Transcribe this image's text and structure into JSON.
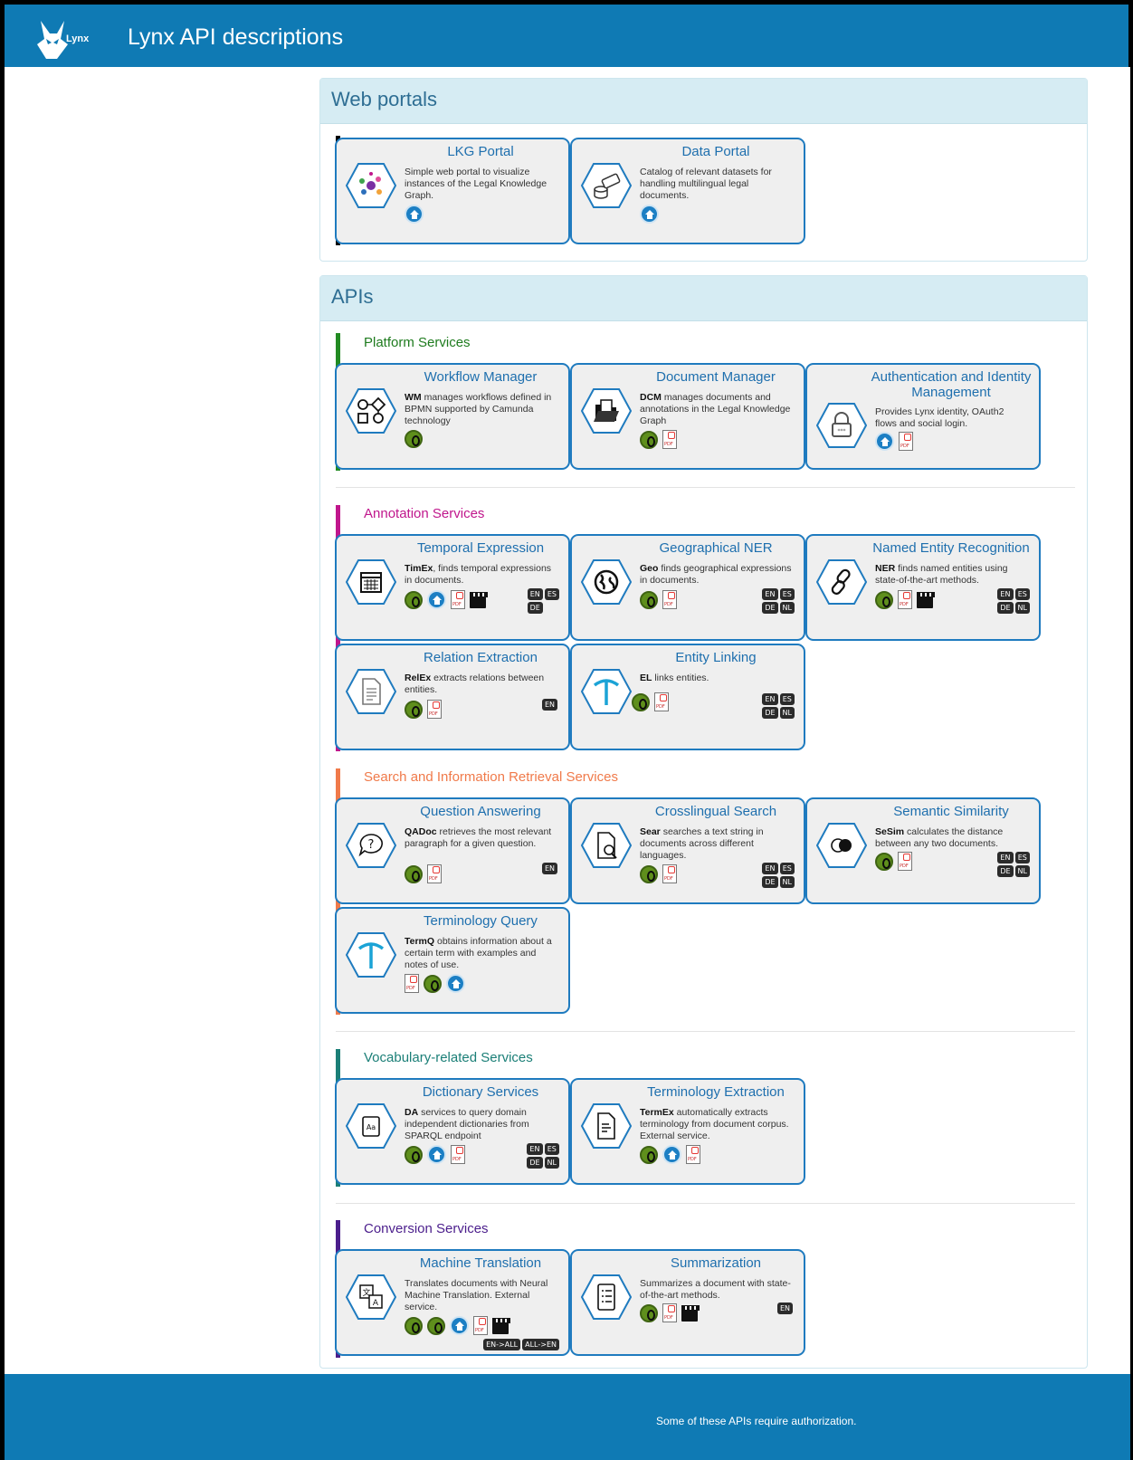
{
  "header": {
    "app_title": "Lynx API descriptions",
    "logo_text": "Lynx"
  },
  "web_portals": {
    "heading": "Web portals",
    "cards": [
      {
        "title": "LKG Portal",
        "description": "Simple web portal to visualize instances of the Legal Knowledge Graph.",
        "icon": "network-graph-icon"
      },
      {
        "title": "Data Portal",
        "description": "Catalog of relevant datasets for handling multilingual legal documents.",
        "icon": "database-tag-icon"
      }
    ]
  },
  "apis": {
    "heading": "APIs",
    "groups": [
      {
        "title": "Platform Services",
        "color": "#228b22",
        "cards": [
          {
            "title": "Workflow Manager",
            "abbr": "WM",
            "description": " manages workflows defined in BPMN supported by Camunda technology",
            "icon": "workflow-icon",
            "links": [
              "swagger"
            ],
            "langs": []
          },
          {
            "title": "Document Manager",
            "abbr": "DCM",
            "description": " manages documents and annotations in the Legal Knowledge Graph",
            "icon": "folder-document-icon",
            "links": [
              "swagger",
              "pdf"
            ],
            "langs": []
          },
          {
            "title": "Authentication and Identity Management",
            "abbr": "",
            "description": "Provides Lynx identity, OAuth2 flows and social login.",
            "icon": "lock-icon",
            "links": [
              "home",
              "pdf"
            ],
            "langs": []
          }
        ]
      },
      {
        "title": "Annotation Services",
        "color": "#c0168c",
        "cards": [
          {
            "title": "Temporal Expression",
            "abbr": "TimEx",
            "description": ", finds temporal expressions in documents.",
            "icon": "calendar-icon",
            "links": [
              "swagger",
              "home",
              "pdf",
              "video"
            ],
            "langs": [
              "EN",
              "ES",
              "DE"
            ]
          },
          {
            "title": "Geographical NER",
            "abbr": "Geo",
            "description": " finds geographical expressions in documents.",
            "icon": "globe-icon",
            "links": [
              "swagger",
              "pdf"
            ],
            "langs": [
              "EN",
              "ES",
              "DE",
              "NL"
            ]
          },
          {
            "title": "Named Entity Recognition",
            "abbr": "NER",
            "description": " finds named entities using state-of-the-art methods.",
            "icon": "link-icon",
            "links": [
              "swagger",
              "pdf",
              "video"
            ],
            "langs": [
              "EN",
              "ES",
              "DE",
              "NL"
            ]
          },
          {
            "title": "Relation Extraction",
            "abbr": "RelEx",
            "description": " extracts relations between entities.",
            "icon": "document-list-icon",
            "links": [
              "swagger",
              "pdf"
            ],
            "langs": [
              "EN"
            ]
          },
          {
            "title": "Entity Linking",
            "abbr": "EL",
            "description": " links entities.",
            "icon": "pickaxe-icon",
            "links": [
              "swagger",
              "pdf"
            ],
            "langs": [
              "EN",
              "ES",
              "DE",
              "NL"
            ]
          }
        ]
      },
      {
        "title": "Search and Information Retrieval Services",
        "color": "#f07a4a",
        "cards": [
          {
            "title": "Question Answering",
            "abbr": "QADoc",
            "description": " retrieves the most relevant paragraph for a given question.",
            "icon": "question-bubble-icon",
            "links": [
              "swagger",
              "pdf"
            ],
            "langs": [
              "EN"
            ]
          },
          {
            "title": "Crosslingual Search",
            "abbr": "Sear",
            "description": " searches a text string in documents across different languages.",
            "icon": "document-search-icon",
            "links": [
              "swagger",
              "pdf"
            ],
            "langs": [
              "EN",
              "ES",
              "DE",
              "NL"
            ]
          },
          {
            "title": "Semantic Similarity",
            "abbr": "SeSim",
            "description": " calculates the distance between any two documents.",
            "icon": "overlap-circles-icon",
            "links": [
              "swagger",
              "pdf"
            ],
            "langs": [
              "EN",
              "ES",
              "DE",
              "NL"
            ]
          },
          {
            "title": "Terminology Query",
            "abbr": "TermQ",
            "description": " obtains information about a certain term with examples and notes of use.",
            "icon": "pickaxe-icon",
            "links": [
              "pdf",
              "swagger",
              "home"
            ],
            "langs": []
          }
        ]
      },
      {
        "title": "Vocabulary-related Services",
        "color": "#1b7f77",
        "cards": [
          {
            "title": "Dictionary Services",
            "abbr": "DA",
            "description": " services to query domain independent dictionaries from SPARQL endpoint",
            "icon": "dictionary-icon",
            "links": [
              "swagger",
              "home",
              "pdf"
            ],
            "langs": [
              "EN",
              "ES",
              "DE",
              "NL"
            ]
          },
          {
            "title": "Terminology Extraction",
            "abbr": "TermEx",
            "description": " automatically extracts terminology from document corpus. External service.",
            "icon": "document-extract-icon",
            "links": [
              "swagger",
              "home",
              "pdf"
            ],
            "langs": []
          }
        ]
      },
      {
        "title": "Conversion Services",
        "color": "#4b1e8c",
        "cards": [
          {
            "title": "Machine Translation",
            "abbr": "",
            "description": "Translates documents with Neural Machine Translation. External service.",
            "icon": "translate-icon",
            "links": [
              "swagger",
              "swagger",
              "home",
              "pdf",
              "video"
            ],
            "langs": [
              "EN->ALL",
              "ALL->EN"
            ]
          },
          {
            "title": "Summarization",
            "abbr": "",
            "description": "Summarizes a document with state-of-the-art methods.",
            "icon": "list-document-icon",
            "links": [
              "swagger",
              "pdf",
              "video"
            ],
            "langs": [
              "EN"
            ]
          }
        ]
      }
    ]
  },
  "footer": {
    "note": "Some of these APIs require authorization."
  }
}
